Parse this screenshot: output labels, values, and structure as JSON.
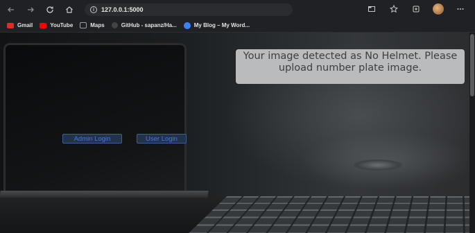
{
  "browser": {
    "url": "127.0.0.1:5000",
    "nav_icons": [
      "back-arrow-icon",
      "forward-arrow-icon",
      "reload-icon",
      "home-icon"
    ],
    "toolbar_icons": [
      "tab-icon",
      "favorites-star-icon",
      "collections-icon",
      "profile-avatar",
      "more-menu-icon"
    ]
  },
  "bookmarks": [
    {
      "label": "Gmail",
      "icon": "gmail-icon",
      "color": "#d93025"
    },
    {
      "label": "YouTube",
      "icon": "youtube-icon",
      "color": "#ff0000"
    },
    {
      "label": "Maps",
      "icon": "maps-icon",
      "color": "#9aa0a6"
    },
    {
      "label": "GitHub - sapanz/Ha...",
      "icon": "github-icon",
      "color": "#444444"
    },
    {
      "label": "My Blog – My Word...",
      "icon": "wordpress-icon",
      "color": "#3b82f6"
    }
  ],
  "page": {
    "result_message": "Your image detected as No Helmet. Please upload number plate image.",
    "admin_login_label": "Admin Login",
    "user_login_label": "User Login"
  },
  "colors": {
    "result_box_bg": "#b9bbbd",
    "button_text": "#4a78c4",
    "chrome_bg": "#202124"
  }
}
